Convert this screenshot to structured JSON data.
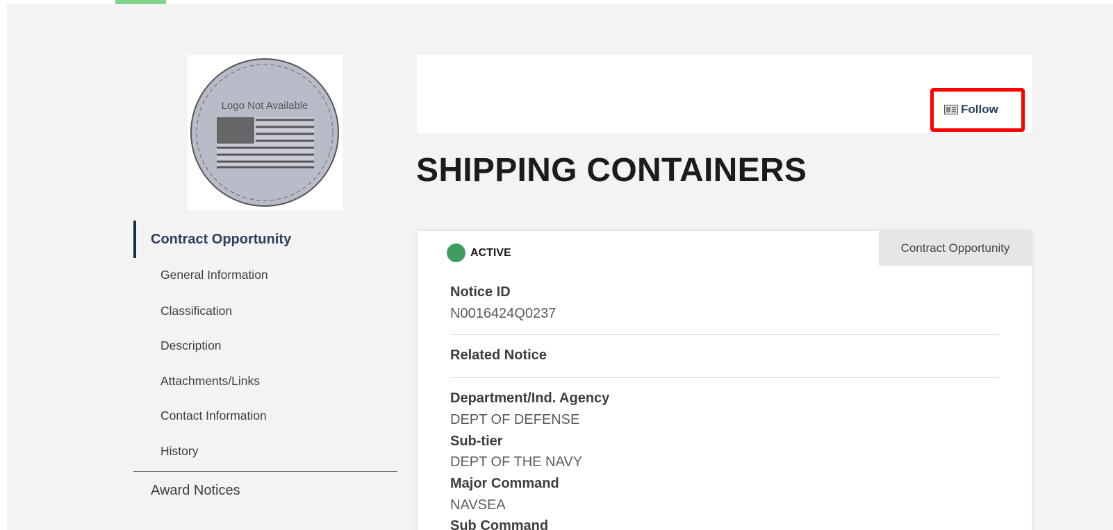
{
  "logo": {
    "text": "Logo Not Available",
    "icon": "logo-not-available-seal"
  },
  "sidebar": {
    "primary": "Contract Opportunity",
    "items": [
      {
        "label": "General Information"
      },
      {
        "label": "Classification"
      },
      {
        "label": "Description"
      },
      {
        "label": "Attachments/Links"
      },
      {
        "label": "Contact Information"
      },
      {
        "label": "History"
      }
    ],
    "award": "Award Notices"
  },
  "header": {
    "follow_label": "Follow",
    "follow_icon": "follow-icon"
  },
  "title": "SHIPPING CONTAINERS",
  "card": {
    "status": "ACTIVE",
    "status_color": "#3f9e5f",
    "type_tab": "Contract Opportunity",
    "fields": {
      "notice_id_label": "Notice ID",
      "notice_id_value": "N0016424Q0237",
      "related_notice_label": "Related Notice",
      "department_label": "Department/Ind. Agency",
      "department_value": "DEPT OF DEFENSE",
      "subtier_label": "Sub-tier",
      "subtier_value": "DEPT OF THE NAVY",
      "major_command_label": "Major Command",
      "major_command_value": "NAVSEA",
      "sub_command_label": "Sub Command"
    }
  },
  "colors": {
    "highlight": "#ff0000",
    "nav_accent": "#162e51",
    "top_accent": "#7ed389"
  }
}
